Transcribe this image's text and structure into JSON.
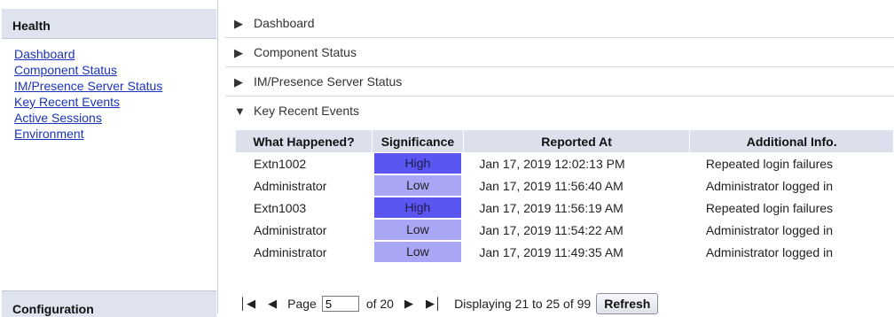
{
  "sidebar": {
    "header": "Health",
    "items": [
      {
        "label": "Dashboard"
      },
      {
        "label": "Component Status"
      },
      {
        "label": "IM/Presence Server Status"
      },
      {
        "label": "Key Recent Events"
      },
      {
        "label": "Active Sessions"
      },
      {
        "label": "Environment"
      }
    ],
    "footer_header": "Configuration"
  },
  "main": {
    "sections": [
      {
        "label": "Dashboard",
        "expanded": false
      },
      {
        "label": "Component Status",
        "expanded": false
      },
      {
        "label": "IM/Presence Server Status",
        "expanded": false
      },
      {
        "label": "Key Recent Events",
        "expanded": true
      }
    ],
    "table": {
      "columns": [
        "What Happened?",
        "Significance",
        "Reported At",
        "Additional Info."
      ],
      "rows": [
        {
          "what": "Extn1002",
          "significance": "High",
          "reported_at": "Jan 17, 2019 12:02:13 PM",
          "info": "Repeated login failures"
        },
        {
          "what": "Administrator",
          "significance": "Low",
          "reported_at": "Jan 17, 2019 11:56:40 AM",
          "info": "Administrator logged in"
        },
        {
          "what": "Extn1003",
          "significance": "High",
          "reported_at": "Jan 17, 2019 11:56:19 AM",
          "info": "Repeated login failures"
        },
        {
          "what": "Administrator",
          "significance": "Low",
          "reported_at": "Jan 17, 2019 11:54:22 AM",
          "info": "Administrator logged in"
        },
        {
          "what": "Administrator",
          "significance": "Low",
          "reported_at": "Jan 17, 2019 11:49:35 AM",
          "info": "Administrator logged in"
        }
      ]
    },
    "pager": {
      "page_label": "Page",
      "page_value": "5",
      "of_label": "of 20",
      "display_text": "Displaying 21 to 25 of 99",
      "refresh_label": "Refresh"
    }
  },
  "colors": {
    "high": "#5b55f2",
    "low": "#a8a6f5",
    "header_bg": "#dce0ec",
    "link": "#1a33b8"
  },
  "icons": {
    "collapsed": "triangle-right-icon",
    "expanded": "triangle-down-icon",
    "first": "first-page-icon",
    "prev": "prev-page-icon",
    "next": "next-page-icon",
    "last": "last-page-icon"
  }
}
